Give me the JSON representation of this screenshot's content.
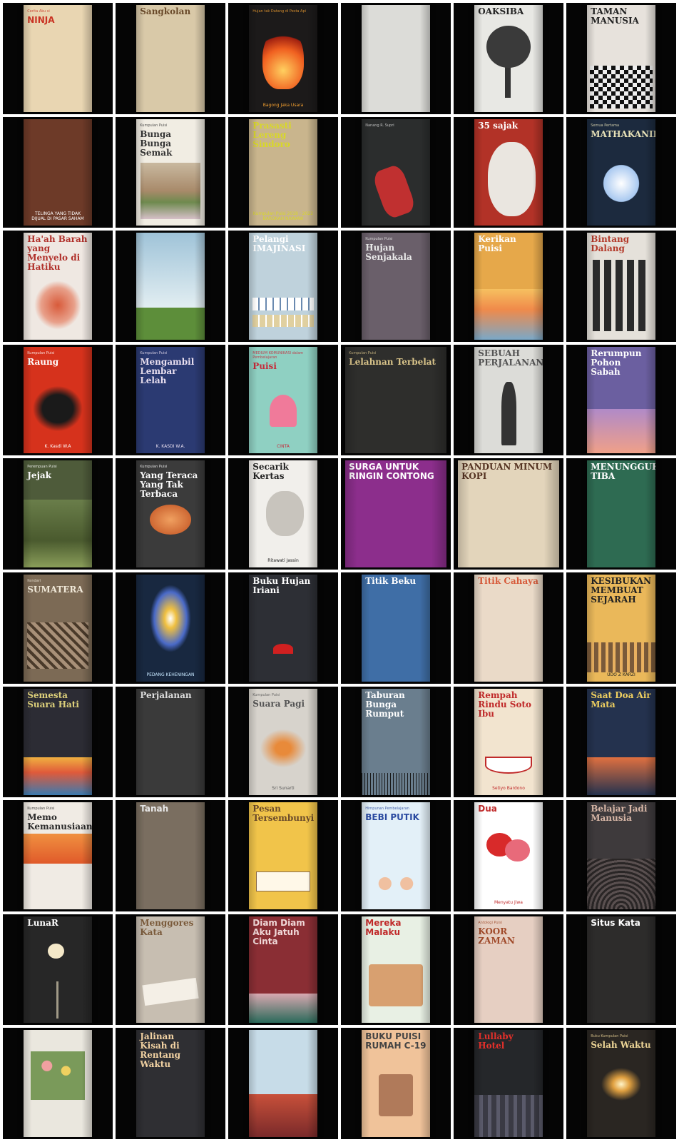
{
  "books": [
    {
      "title": "NINJA",
      "pre": "Cerita Aku si",
      "author": "",
      "bg": "#e9d6b2",
      "fg": "#c93222",
      "style": "s"
    },
    {
      "title": "Sangkolan",
      "pre": "",
      "author": "",
      "bg": "#d9c9a8",
      "fg": "#6a4a2a",
      "style": "serif"
    },
    {
      "title": "",
      "pre": "Hujan tak Datang di Pesta Api",
      "author": "Bagong Jaka Usara",
      "bg": "#1c1a1a",
      "fg": "#f4a030",
      "art": "fire"
    },
    {
      "title": "",
      "pre": "",
      "author": "",
      "bg": "#dcdcd8",
      "fg": "#222222"
    },
    {
      "title": "OAKSIBA",
      "pre": "",
      "author": "",
      "bg": "#e8e8e4",
      "fg": "#222222",
      "art": "tree"
    },
    {
      "title": "TAMAN MANUSIA",
      "pre": "",
      "author": "",
      "bg": "#e7e2dc",
      "fg": "#222222",
      "art": "checker"
    },
    {
      "title": "",
      "pre": "",
      "author": "TELINGA YANG TIDAK DIJUAL DI PASAR SAHAM",
      "bg": "#6d3a28",
      "fg": "#ffffff"
    },
    {
      "title": "Bunga Bunga Semak",
      "pre": "Kumpulan Puisi",
      "author": "",
      "bg": "#f1ede3",
      "fg": "#333333",
      "art": "village"
    },
    {
      "title": "Prasasti Lereng Sindoro",
      "pre": "",
      "author": "Kumpulan Puisi 2018 - 2022 BAROKAH NAWAWI",
      "bg": "#c9b58d",
      "fg": "#d8d72a"
    },
    {
      "title": "",
      "pre": "Nanang R. Supri",
      "author": "",
      "bg": "#2b2d2d",
      "fg": "#dddddd",
      "art": "hand"
    },
    {
      "title": "35 sajak",
      "pre": "",
      "author": "",
      "bg": "#b23227",
      "fg": "#ffffff",
      "art": "portrait"
    },
    {
      "title": "MATHAKANIKA",
      "pre": "Semua Pertama",
      "author": "",
      "bg": "#1c2a3e",
      "fg": "#e8e2b8",
      "art": "flowers"
    },
    {
      "title": "Ha'ah Barah yang Menyelo di Hatiku",
      "pre": "",
      "author": "",
      "bg": "#efe8e2",
      "fg": "#b0302a",
      "art": "tree2"
    },
    {
      "title": "",
      "pre": "",
      "author": "",
      "bg": "#cfdde4",
      "fg": "#333333",
      "art": "sky"
    },
    {
      "title": "Pelangi IMAJINASI",
      "pre": "",
      "author": "",
      "bg": "#bfd2dc",
      "fg": "#ffffff",
      "art": "strips"
    },
    {
      "title": "Hujan Senjakala",
      "pre": "Kumpulan Puisi",
      "author": "",
      "bg": "#6a5f6a",
      "fg": "#eaeaea"
    },
    {
      "title": "Kerikan Puisi",
      "pre": "",
      "author": "",
      "bg": "#e6a84a",
      "fg": "#ffffff",
      "art": "sunset"
    },
    {
      "title": "Bintang Dalang",
      "pre": "",
      "author": "",
      "bg": "#e5e1da",
      "fg": "#b33a2a",
      "art": "dancers"
    },
    {
      "title": "Raung",
      "pre": "Kumpulan Puisi",
      "author": "K. Kasdi W.A",
      "bg": "#d6321c",
      "fg": "#ffffff",
      "art": "dark"
    },
    {
      "title": "Mengambil Lembar Lelah",
      "pre": "Kumpulan Puisi",
      "author": "K. KASDI W.A.",
      "bg": "#2b3a72",
      "fg": "#e9dff0"
    },
    {
      "title": "Puisi",
      "pre": "MEDIUM KOMUNIKASI dalam Pembelajaran",
      "author": "CINTA",
      "bg": "#8fd0c2",
      "fg": "#c62a3a",
      "art": "heart"
    },
    {
      "title": "Lelahnan Terbelat",
      "pre": "Kumpulan Puisi",
      "author": "",
      "bg": "#2e2e2c",
      "fg": "#d9c48a",
      "wide": true
    },
    {
      "title": "SEBUAH PERJALANAN",
      "pre": "",
      "author": "",
      "bg": "#dcdcd8",
      "fg": "#555555",
      "art": "traveler"
    },
    {
      "title": "Rerumpun Pohon Sabah",
      "pre": "",
      "author": "",
      "bg": "#6b5fa0",
      "fg": "#ffffff",
      "art": "pier"
    },
    {
      "title": "Jejak",
      "pre": "Perempuan Puisi",
      "author": "",
      "bg": "#4e5b3a",
      "fg": "#ffffff",
      "art": "forest"
    },
    {
      "title": "Yang Teraca Yang Tak Terbaca",
      "pre": "Kumpulan Puisi",
      "author": "",
      "bg": "#3b3b3b",
      "fg": "#ffffff",
      "art": "orb"
    },
    {
      "title": "Secarik Kertas",
      "pre": "",
      "author": "Ritawati Jassin",
      "bg": "#f1efeb",
      "fg": "#222222",
      "art": "face"
    },
    {
      "title": "SURGA UNTUK RINGIN CONTONG",
      "pre": "",
      "author": "",
      "bg": "#8c2e8c",
      "fg": "#ffffff",
      "wide": true,
      "style": "s"
    },
    {
      "title": "PANDUAN MINUM KOPI",
      "pre": "",
      "author": "",
      "bg": "#e3d5bb",
      "fg": "#553322",
      "wide": true
    },
    {
      "title": "MENUNGGUKU TIBA",
      "pre": "",
      "author": "",
      "bg": "#2e6b52",
      "fg": "#ffffff"
    },
    {
      "title": "SUMATERA",
      "pre": "Kendari",
      "author": "",
      "bg": "#7c6a55",
      "fg": "#f0e8d8",
      "art": "ruins"
    },
    {
      "title": "",
      "pre": "",
      "author": "PEDANG KEHENINGAN",
      "bg": "#182840",
      "fg": "#c8e8ff",
      "art": "glow"
    },
    {
      "title": "Buku Hujan Iriani",
      "pre": "",
      "author": "",
      "bg": "#2d2f35",
      "fg": "#ffffff",
      "art": "umbrella"
    },
    {
      "title": "Titik Beku",
      "pre": "",
      "author": "",
      "bg": "#3f6ea6",
      "fg": "#ffffff"
    },
    {
      "title": "Titik Cahaya",
      "pre": "",
      "author": "",
      "bg": "#eadac8",
      "fg": "#d75a3a"
    },
    {
      "title": "KESIBUKAN MEMBUAT SEJARAH",
      "pre": "",
      "author": "UDO Z KARZI",
      "bg": "#eab85a",
      "fg": "#222222",
      "art": "city"
    },
    {
      "title": "Semesta Suara Hati",
      "pre": "",
      "author": "",
      "bg": "#2c2c34",
      "fg": "#dccf7a",
      "art": "beach"
    },
    {
      "title": "Perjalanan",
      "pre": "",
      "author": "",
      "bg": "#3a3a3a",
      "fg": "#dddddd"
    },
    {
      "title": "Suara Pagi",
      "pre": "Kumpulan Puisi",
      "author": "Sri Sunarti",
      "bg": "#d7d3cc",
      "fg": "#555555",
      "art": "birds"
    },
    {
      "title": "Taburan Bunga Rumput",
      "pre": "",
      "author": "",
      "bg": "#6a7e8e",
      "fg": "#ffffff",
      "art": "grass"
    },
    {
      "title": "Rempah Rindu Soto Ibu",
      "pre": "",
      "author": "Setiyo Bardono",
      "bg": "#f2e4cf",
      "fg": "#c02a2a",
      "art": "bowl"
    },
    {
      "title": "Saat Doa Air Mata",
      "pre": "",
      "author": "",
      "bg": "#24324e",
      "fg": "#f0d060",
      "art": "moon"
    },
    {
      "title": "Memo Kemanusiaan",
      "pre": "Kumpulan Puisi",
      "author": "",
      "bg": "#f0ebe4",
      "fg": "#2a2a2a",
      "art": "dove"
    },
    {
      "title": "Tanah",
      "pre": "",
      "author": "",
      "bg": "#7a6e60",
      "fg": "#eaeaea",
      "style": "s"
    },
    {
      "title": "Pesan Tersembunyi",
      "pre": "",
      "author": "",
      "bg": "#f1c44a",
      "fg": "#6a4a2a",
      "art": "book"
    },
    {
      "title": "BEBI PUTIK",
      "pre": "Himpunan Pembelajaran",
      "author": "",
      "bg": "#e3f0f8",
      "fg": "#2a4aa0",
      "art": "kids",
      "style": "s"
    },
    {
      "title": "Dua",
      "pre": "",
      "author": "Menyatu Jiwa",
      "bg": "#ffffff",
      "fg": "#c02a2a",
      "art": "hearts",
      "style": "s"
    },
    {
      "title": "Belajar Jadi Manusia",
      "pre": "",
      "author": "",
      "bg": "#3e3a3c",
      "fg": "#d9b8a8",
      "art": "swirl"
    },
    {
      "title": "LunaR",
      "pre": "",
      "author": "",
      "bg": "#272727",
      "fg": "#ffffff",
      "art": "lunar"
    },
    {
      "title": "Menggores Kata",
      "pre": "",
      "author": "",
      "bg": "#c7beb1",
      "fg": "#7a5a3a",
      "art": "pen"
    },
    {
      "title": "Diam Diam Aku Jatuh Cinta",
      "pre": "",
      "author": "",
      "bg": "#8a2e34",
      "fg": "#f0d8d8",
      "art": "swing",
      "style": "s"
    },
    {
      "title": "Mereka Malaku",
      "pre": "",
      "author": "",
      "bg": "#e8f0e4",
      "fg": "#c02a2a",
      "art": "school",
      "style": "s"
    },
    {
      "title": "KOOR ZAMAN",
      "pre": "Antologi Puisi",
      "author": "",
      "bg": "#e6cfc2",
      "fg": "#a04a2a"
    },
    {
      "title": "Situs Kata",
      "pre": "",
      "author": "",
      "bg": "#2d2c2b",
      "fg": "#ffffff",
      "style": "s"
    },
    {
      "title": "",
      "pre": "",
      "author": "",
      "bg": "#eae7de",
      "fg": "#333333",
      "art": "garden"
    },
    {
      "title": "Jalinan Kisah di Rentang Waktu",
      "pre": "",
      "author": "",
      "bg": "#2f2f33",
      "fg": "#f4d4a4"
    },
    {
      "title": "",
      "pre": "",
      "author": "",
      "bg": "#c7dce8",
      "fg": "#333333",
      "art": "harbor"
    },
    {
      "title": "BUKU PUISI RUMAH C-19",
      "pre": "",
      "author": "",
      "bg": "#f0c39a",
      "fg": "#444444",
      "art": "house",
      "style": "s"
    },
    {
      "title": "Lullaby Hotel",
      "pre": "",
      "author": "",
      "bg": "#25272a",
      "fg": "#e4302a",
      "art": "cityscape"
    },
    {
      "title": "Selah Waktu",
      "pre": "Buku Kumpulan Puisi",
      "author": "",
      "bg": "#2a2622",
      "fg": "#f0d898",
      "art": "sparkle"
    }
  ]
}
